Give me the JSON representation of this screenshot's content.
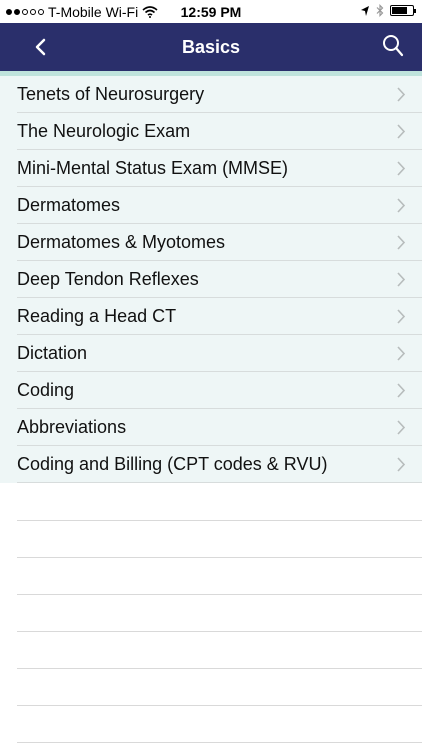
{
  "status_bar": {
    "carrier": "T-Mobile Wi-Fi",
    "time": "12:59 PM",
    "signal_bars_filled": 2,
    "signal_bars_total": 5,
    "battery_level": 0.75,
    "icons": [
      "wifi-icon",
      "location-arrow-icon",
      "bluetooth-icon",
      "battery-icon"
    ]
  },
  "nav": {
    "title": "Basics",
    "back_icon": "chevron-left-icon",
    "search_icon": "search-icon",
    "background_color": "#2a2f6b",
    "accent_color": "#bfe3dc"
  },
  "list": {
    "items": [
      {
        "label": "Tenets of Neurosurgery"
      },
      {
        "label": "The Neurologic Exam"
      },
      {
        "label": "Mini-Mental Status Exam (MMSE)"
      },
      {
        "label": "Dermatomes"
      },
      {
        "label": "Dermatomes & Myotomes"
      },
      {
        "label": "Deep Tendon Reflexes"
      },
      {
        "label": "Reading a Head CT"
      },
      {
        "label": "Dictation"
      },
      {
        "label": "Coding"
      },
      {
        "label": "Abbreviations"
      },
      {
        "label": "Coding and Billing (CPT codes & RVU)"
      }
    ],
    "chevron_icon": "chevron-right-icon",
    "background_color": "#eef6f6"
  }
}
